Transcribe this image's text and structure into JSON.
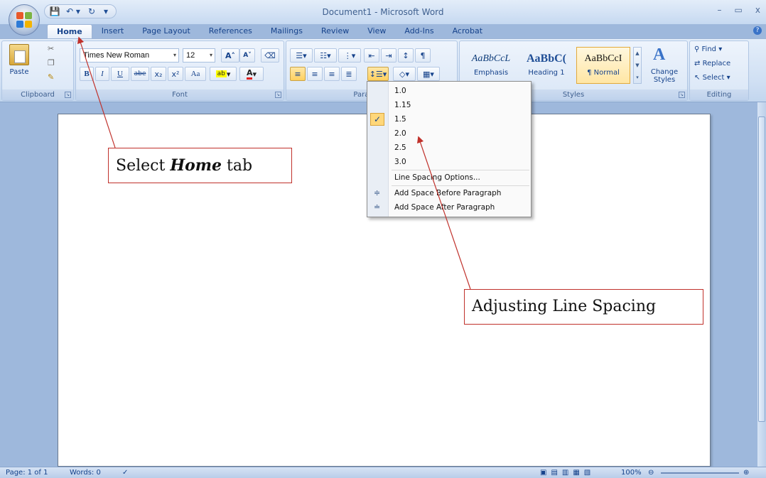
{
  "window": {
    "title": "Document1 - Microsoft Word",
    "min": "–",
    "max": "▭",
    "close": "x"
  },
  "qat": {
    "save": "💾",
    "undo": "↶ ▾",
    "redo": "↻",
    "more": "▾"
  },
  "tabs": [
    "Home",
    "Insert",
    "Page Layout",
    "References",
    "Mailings",
    "Review",
    "View",
    "Add-Ins",
    "Acrobat"
  ],
  "ribbon": {
    "clipboard": {
      "paste": "Paste",
      "label": "Clipboard"
    },
    "font": {
      "name": "Times New Roman",
      "size": "12",
      "label": "Font",
      "bold": "B",
      "italic": "I",
      "underline": "U",
      "strike": "abe",
      "sub": "x₂",
      "sup": "x²",
      "case": "Aa",
      "grow": "A˄",
      "shrink": "A˅"
    },
    "paragraph": {
      "label": "Paragraph"
    },
    "styles": {
      "label": "Styles",
      "items": [
        {
          "sample": "AaBbCcL",
          "name": "Emphasis"
        },
        {
          "sample": "AaBbC(",
          "name": "Heading 1"
        },
        {
          "sample": "AaBbCcI",
          "name": "¶ Normal"
        }
      ],
      "change": "Change Styles"
    },
    "editing": {
      "label": "Editing",
      "find": "Find",
      "replace": "Replace",
      "select": "Select"
    }
  },
  "menu": {
    "items": [
      "1.0",
      "1.15",
      "1.5",
      "2.0",
      "2.5",
      "3.0"
    ],
    "checked": "2.0",
    "options": "Line Spacing Options...",
    "before": "Add Space Before Paragraph",
    "after": "Add Space After Paragraph"
  },
  "status": {
    "page": "Page: 1 of 1",
    "words": "Words: 0",
    "zoom": "100%"
  },
  "callouts": {
    "home_pre": "Select ",
    "home_em": "Home",
    "home_post": " tab",
    "spacing": "Adjusting Line Spacing"
  }
}
